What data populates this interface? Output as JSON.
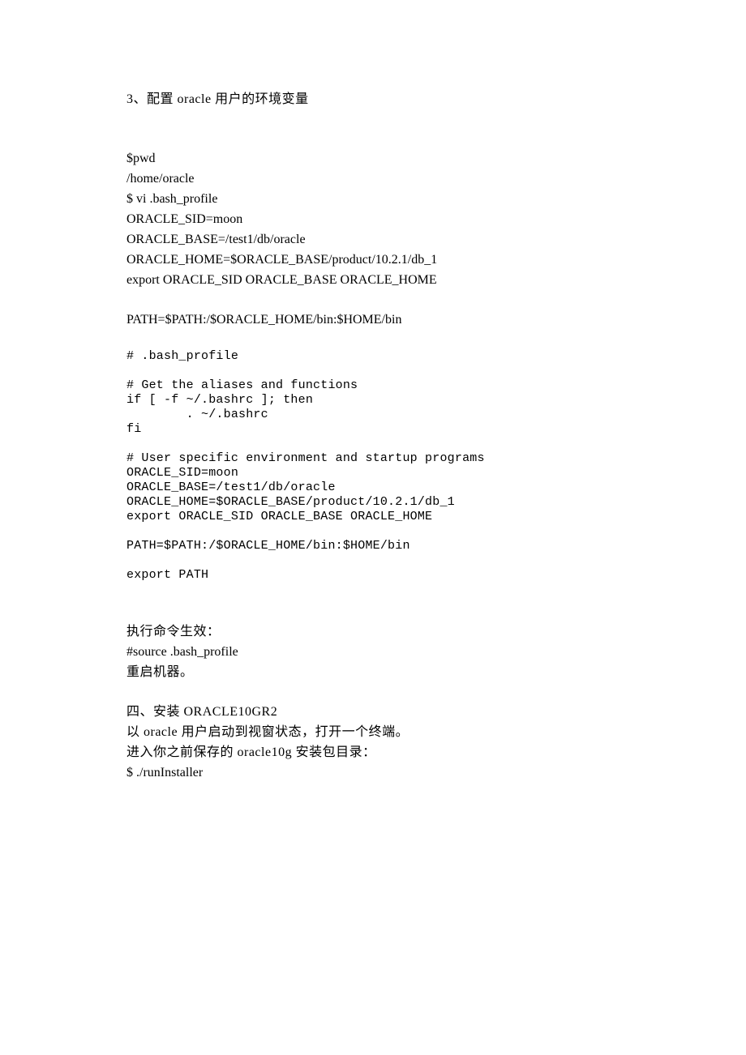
{
  "doc": {
    "section3_title": "3、配置 oracle 用户的环境变量",
    "cmd_block1": [
      "$pwd",
      "/home/oracle",
      "$ vi .bash_profile",
      "ORACLE_SID=moon",
      "ORACLE_BASE=/test1/db/oracle",
      "ORACLE_HOME=$ORACLE_BASE/product/10.2.1/db_1",
      "export ORACLE_SID ORACLE_BASE ORACLE_HOME"
    ],
    "path_line": "PATH=$PATH:/$ORACLE_HOME/bin:$HOME/bin",
    "profile_dump": "# .bash_profile\n\n# Get the aliases and functions\nif [ -f ~/.bashrc ]; then\n        . ~/.bashrc\nfi\n\n# User specific environment and startup programs\nORACLE_SID=moon\nORACLE_BASE=/test1/db/oracle\nORACLE_HOME=$ORACLE_BASE/product/10.2.1/db_1\nexport ORACLE_SID ORACLE_BASE ORACLE_HOME\n\nPATH=$PATH:/$ORACLE_HOME/bin:$HOME/bin\n\nexport PATH",
    "exec_heading": "执行命令生效：",
    "source_cmd": "#source .bash_profile",
    "reboot": "重启机器。",
    "section4_title": "四、安装 ORACLE10GR2",
    "section4_line1": "以 oracle 用户启动到视窗状态，打开一个终端。",
    "section4_line2": "进入你之前保存的 oracle10g 安装包目录：",
    "run_installer": "$ ./runInstaller"
  }
}
